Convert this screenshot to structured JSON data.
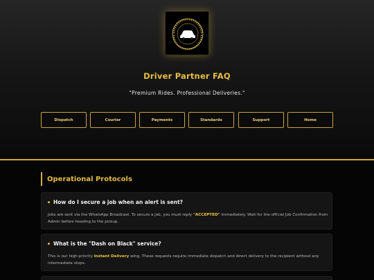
{
  "header": {
    "title": "Driver Partner FAQ",
    "tagline": "\"Premium Rides. Professional Deliveries.\"",
    "logo_icon": "car-logo-icon",
    "logo_text": "CARDIFF EXECUTIVE RIDESHARE & LOGISTICS"
  },
  "nav": {
    "items": [
      {
        "label": "Dispatch"
      },
      {
        "label": "Courier"
      },
      {
        "label": "Payments"
      },
      {
        "label": "Standards"
      },
      {
        "label": "Support"
      },
      {
        "label": "Home"
      }
    ]
  },
  "section": {
    "title": "Operational Protocols"
  },
  "faq": [
    {
      "question": "How do I secure a job when an alert is sent?",
      "answer_pre": "Jobs are sent via the WhatsApp Broadcast. To secure a job, you must reply ",
      "answer_highlight": "\"ACCEPTED\"",
      "answer_post": " immediately. Wait for the official Job Confirmation from Admin before heading to the pickup."
    },
    {
      "question": "What is the \"Dash on Black\" service?",
      "answer_pre": "This is our high-priority ",
      "answer_highlight": "Instant Delivery",
      "answer_post": " wing. These requests require immediate dispatch and direct delivery to the recipient without any intermediate stops."
    }
  ],
  "colors": {
    "accent": "#e5bc43",
    "background": "#050505",
    "card": "#151515"
  }
}
